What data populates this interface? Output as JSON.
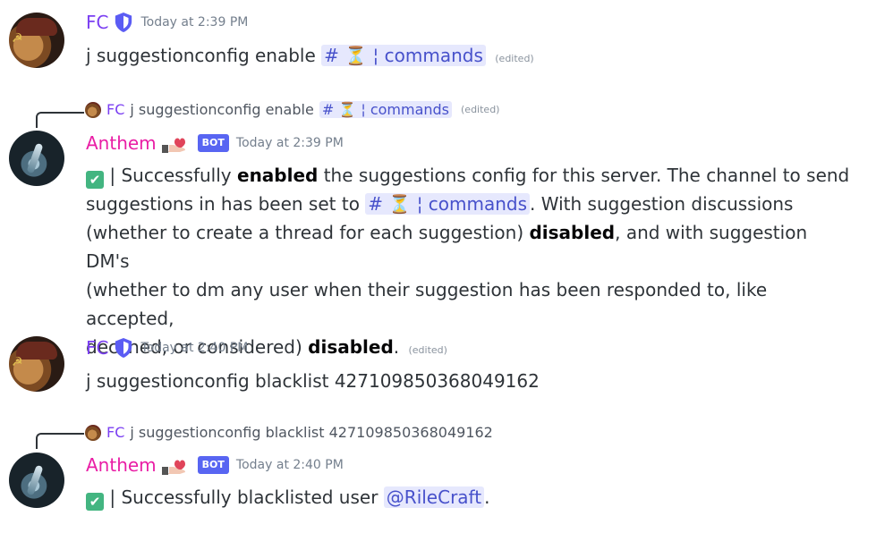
{
  "messages": [
    {
      "author": "FC",
      "timestamp": "Today at 2:39 PM",
      "content_prefix": "j suggestionconfig enable",
      "channel_mention": {
        "hash": "#",
        "emoji": "⏳",
        "sep": "¦",
        "name": "commands"
      },
      "edited": "(edited)"
    },
    {
      "reply_preview": {
        "author": "FC",
        "text": "j suggestionconfig enable",
        "channel_mention": {
          "hash": "#",
          "emoji": "⏳",
          "sep": "¦",
          "name": "commands"
        },
        "edited": "(edited)"
      },
      "author": "Anthem",
      "bot_tag": "BOT",
      "timestamp": "Today at 2:39 PM",
      "line1_a": "| Successfully",
      "line1_bold": "enabled",
      "line1_b": "the suggestions config for this server. The channel to send",
      "line2_a": "suggestions in has been set to",
      "channel_mention": {
        "hash": "#",
        "emoji": "⏳",
        "sep": "¦",
        "name": "commands"
      },
      "line2_b": ". With suggestion discussions",
      "line3_a": "(whether to create a thread for each suggestion)",
      "line3_bold": "disabled",
      "line3_b": ", and with suggestion DM's",
      "line4": "(whether to dm any user when their suggestion has been responded to, like accepted,",
      "line5_a": "declined, or considered)",
      "line5_bold": "disabled",
      "line5_b": ".",
      "edited": "(edited)"
    },
    {
      "author": "FC",
      "timestamp": "Today at 2:40 PM",
      "content": "j suggestionconfig blacklist 427109850368049162"
    },
    {
      "reply_preview": {
        "author": "FC",
        "text": "j suggestionconfig blacklist 427109850368049162"
      },
      "author": "Anthem",
      "bot_tag": "BOT",
      "timestamp": "Today at 2:40 PM",
      "content_prefix": "| Successfully blacklisted user",
      "user_mention": "@RileCraft",
      "content_suffix": "."
    }
  ],
  "icons": {
    "shield": "shield-icon",
    "cake": "hand-heart-icon",
    "check": "check-mark-icon"
  }
}
